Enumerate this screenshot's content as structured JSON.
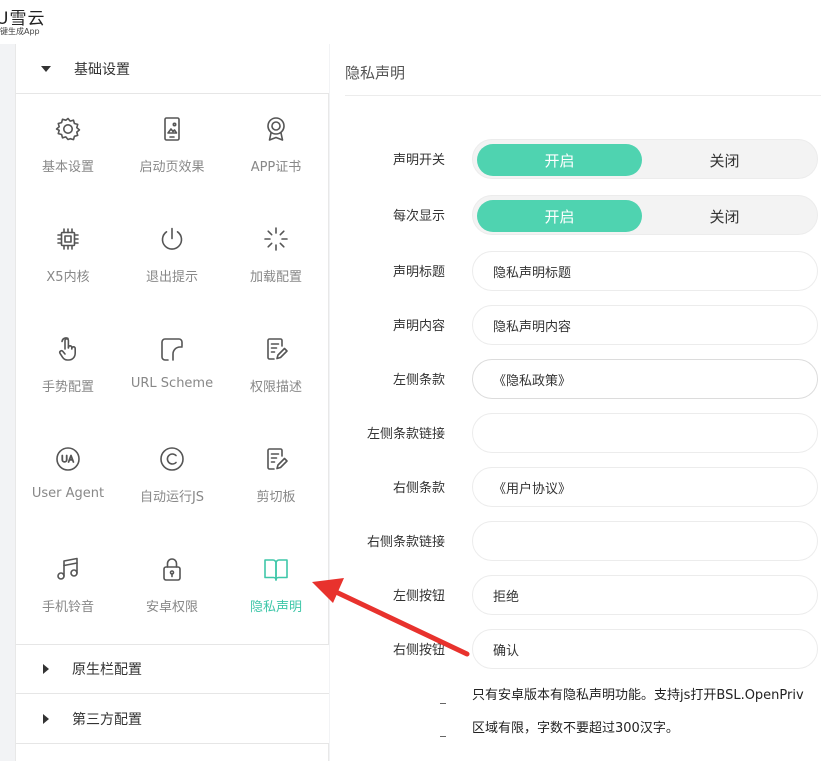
{
  "logo": {
    "title": "U雪云",
    "subtitle": "键生成App"
  },
  "sidebar": {
    "sections": [
      {
        "label": "基础设置",
        "expanded": true
      },
      {
        "label": "原生栏配置",
        "expanded": false
      },
      {
        "label": "第三方配置",
        "expanded": false
      }
    ],
    "grid": [
      {
        "label": "基本设置",
        "icon": "gear-icon"
      },
      {
        "label": "启动页效果",
        "icon": "phone-image-icon"
      },
      {
        "label": "APP证书",
        "icon": "certificate-icon"
      },
      {
        "label": "X5内核",
        "icon": "chip-icon"
      },
      {
        "label": "退出提示",
        "icon": "power-icon"
      },
      {
        "label": "加载配置",
        "icon": "loading-spinner-icon"
      },
      {
        "label": "手势配置",
        "icon": "hand-pointer-icon"
      },
      {
        "label": "URL Scheme",
        "icon": "url-scheme-icon"
      },
      {
        "label": "权限描述",
        "icon": "edit-document-icon"
      },
      {
        "label": "User Agent",
        "icon": "ua-icon"
      },
      {
        "label": "自动运行JS",
        "icon": "copyright-icon"
      },
      {
        "label": "剪切板",
        "icon": "clipboard-edit-icon"
      },
      {
        "label": "手机铃音",
        "icon": "music-note-icon"
      },
      {
        "label": "安卓权限",
        "icon": "lock-icon"
      },
      {
        "label": "隐私声明",
        "icon": "book-icon",
        "active": true
      }
    ]
  },
  "main": {
    "title": "隐私声明",
    "fields": [
      {
        "label": "声明开关",
        "type": "toggle",
        "on": "开启",
        "off": "关闭",
        "value": "开启"
      },
      {
        "label": "每次显示",
        "type": "toggle",
        "on": "开启",
        "off": "关闭",
        "value": "开启"
      },
      {
        "label": "声明标题",
        "type": "text",
        "value": "隐私声明标题"
      },
      {
        "label": "声明内容",
        "type": "text",
        "value": "隐私声明内容"
      },
      {
        "label": "左侧条款",
        "type": "text",
        "value": "《隐私政策》"
      },
      {
        "label": "左侧条款链接",
        "type": "text",
        "value": ""
      },
      {
        "label": "右侧条款",
        "type": "text",
        "value": "《用户协议》"
      },
      {
        "label": "右侧条款链接",
        "type": "text",
        "value": ""
      },
      {
        "label": "左侧按钮",
        "type": "text",
        "value": "拒绝"
      },
      {
        "label": "右侧按钮",
        "type": "text",
        "value": "确认"
      }
    ],
    "hints": [
      "只有安卓版本有隐私声明功能。支持js打开BSL.OpenPriv",
      "区域有限，字数不要超过300汉字。"
    ]
  },
  "colors": {
    "accent": "#4fd3b0",
    "active_text": "#3fc7a9",
    "arrow": "#e8322d"
  }
}
